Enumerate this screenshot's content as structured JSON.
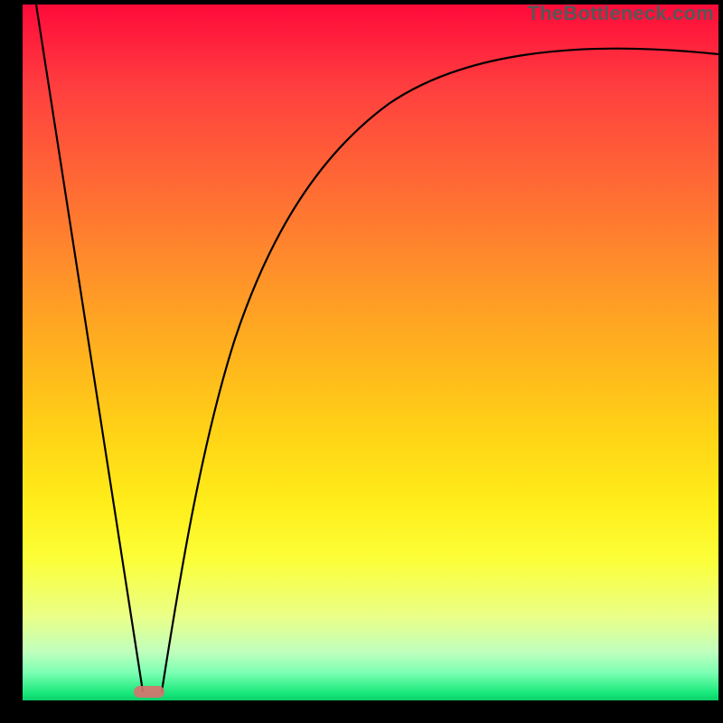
{
  "meta": {
    "watermark": "TheBottleneck.com"
  },
  "chart_data": {
    "type": "line",
    "title": "",
    "xlabel": "",
    "ylabel": "",
    "xlim": [
      0,
      100
    ],
    "ylim": [
      0,
      100
    ],
    "grid": false,
    "legend": false,
    "background": "vertical-gradient red→green",
    "series": [
      {
        "name": "bottleneck-curve",
        "x": [
          0,
          2,
          4,
          6,
          8,
          10,
          12,
          14,
          16,
          17,
          18,
          19,
          20,
          22,
          24,
          26,
          28,
          30,
          33,
          36,
          40,
          45,
          50,
          55,
          60,
          65,
          70,
          75,
          80,
          85,
          90,
          95,
          100
        ],
        "y": [
          100,
          88,
          76,
          64,
          53,
          41,
          29,
          17,
          6,
          0,
          0,
          0,
          5,
          16,
          27,
          37,
          45,
          52,
          60,
          66,
          72,
          77,
          80,
          83,
          85,
          87,
          88.5,
          89.5,
          90.5,
          91,
          91.5,
          92,
          92.5
        ]
      }
    ],
    "markers": [
      {
        "name": "optimal-point",
        "x": 18,
        "y": 0,
        "color": "#d6736f"
      }
    ]
  },
  "colors": {
    "gradient_top": "#ff0a3a",
    "gradient_bottom": "#0ccf6a",
    "curve": "#000000",
    "marker": "#d6736f",
    "frame": "#000000",
    "watermark": "#575757"
  }
}
